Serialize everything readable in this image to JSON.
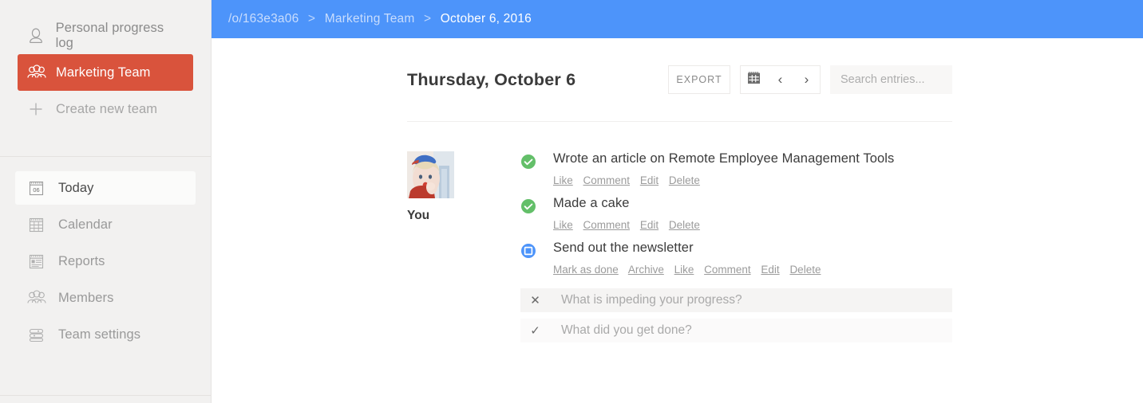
{
  "sidebar": {
    "teams": [
      {
        "label": "Personal progress log",
        "icon": "user-icon",
        "state": "normal"
      },
      {
        "label": "Marketing Team",
        "icon": "group-icon",
        "state": "active"
      },
      {
        "label": "Create new team",
        "icon": "plus-icon",
        "state": "muted"
      }
    ],
    "nav": [
      {
        "label": "Today",
        "icon": "calendar-day-icon",
        "badge": "06",
        "state": "active"
      },
      {
        "label": "Calendar",
        "icon": "calendar-grid-icon",
        "state": "normal"
      },
      {
        "label": "Reports",
        "icon": "report-icon",
        "state": "normal"
      },
      {
        "label": "Members",
        "icon": "members-icon",
        "state": "normal"
      },
      {
        "label": "Team settings",
        "icon": "settings-stack-icon",
        "state": "normal"
      }
    ],
    "active_color": "#d9533c",
    "background": "#f2f1f0"
  },
  "topbar": {
    "background": "#4d94fa",
    "breadcrumb": {
      "org": "/o/163e3a06",
      "team": "Marketing Team",
      "current": "October 6, 2016",
      "separator": ">"
    }
  },
  "header": {
    "day_title": "Thursday, October 6",
    "export_label": "EXPORT",
    "calendar_icon": "calendar-icon",
    "prev_label": "‹",
    "next_label": "›",
    "search": {
      "value": "",
      "placeholder": "Search entries..."
    }
  },
  "author": {
    "name": "You",
    "avatar_alt": "avatar-photo"
  },
  "entries": [
    {
      "status": "done",
      "status_icon": "check-circle-icon",
      "status_color": "#63bf69",
      "text": "Wrote an article on Remote Employee Management Tools",
      "actions": [
        "Like",
        "Comment",
        "Edit",
        "Delete"
      ]
    },
    {
      "status": "done",
      "status_icon": "check-circle-icon",
      "status_color": "#63bf69",
      "text": "Made a cake",
      "actions": [
        "Like",
        "Comment",
        "Edit",
        "Delete"
      ]
    },
    {
      "status": "pending",
      "status_icon": "square-circle-icon",
      "status_color": "#4d94fa",
      "text": "Send out the newsletter",
      "actions": [
        "Mark as done",
        "Archive",
        "Like",
        "Comment",
        "Edit",
        "Delete"
      ]
    }
  ],
  "compose": [
    {
      "icon": "x-icon",
      "icon_glyph": "✕",
      "value": "",
      "placeholder": "What is impeding your progress?",
      "kind": "blocker"
    },
    {
      "icon": "check-icon",
      "icon_glyph": "✓",
      "value": "",
      "placeholder": "What did you get done?",
      "kind": "done"
    }
  ]
}
